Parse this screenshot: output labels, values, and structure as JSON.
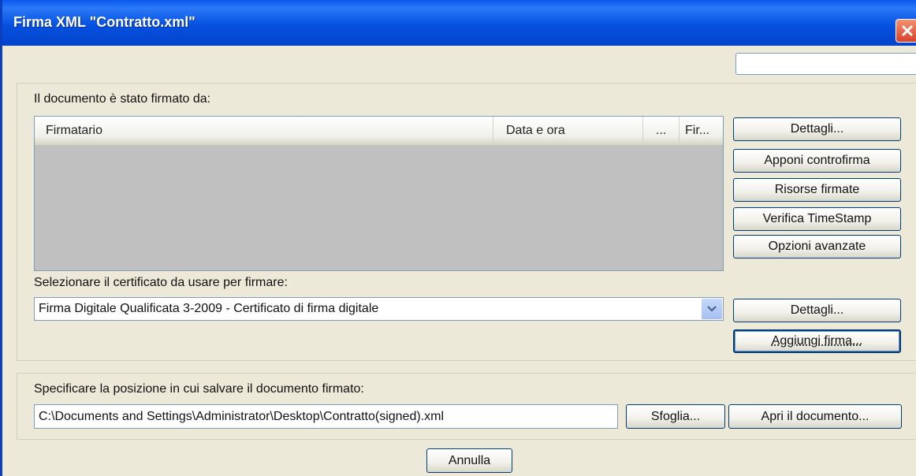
{
  "window": {
    "title": "Firma XML \"Contratto.xml\"",
    "close_icon": "close-icon"
  },
  "signed_section": {
    "label": "Il documento è stato firmato da:",
    "columns": [
      "Firmatario",
      "Data e ora",
      "...",
      "Fir..."
    ],
    "rows": []
  },
  "side_buttons": {
    "details": "Dettagli...",
    "countersign": "Apponi controfirma",
    "signed_resources": "Risorse firmate",
    "verify_timestamp": "Verifica TimeStamp",
    "advanced_options": "Opzioni avanzate"
  },
  "certificate": {
    "label": "Selezionare il certificato da usare per firmare:",
    "selected": "Firma Digitale Qualificata 3-2009 - Certificato di firma digitale",
    "details_button": "Dettagli...",
    "add_signature_button": "Aggiungi firma..."
  },
  "save": {
    "label": "Specificare la posizione in cui salvare il documento firmato:",
    "path": "C:\\Documents and Settings\\Administrator\\Desktop\\Contratto(signed).xml",
    "browse_button": "Sfoglia...",
    "open_button": "Apri il documento..."
  },
  "footer": {
    "cancel_button": "Annulla"
  }
}
